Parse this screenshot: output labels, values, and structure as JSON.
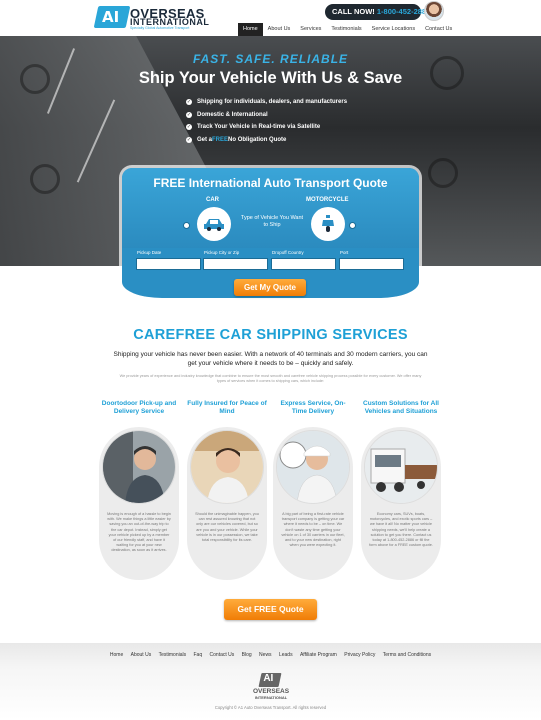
{
  "header": {
    "logo_line1": "OVERSEAS",
    "logo_line2": "INTERNATIONAL",
    "logo_tagline": "Specialty Global Automotive Transport",
    "call_label": "CALL NOW!",
    "phone": "1-800-452-2886",
    "nav": [
      "Home",
      "About Us",
      "Services",
      "Testimonials",
      "Service Locations",
      "Contact Us"
    ],
    "nav_active": "Home"
  },
  "hero": {
    "tagline": "FAST. SAFE. RELIABLE",
    "title": "Ship Your Vehicle With Us & Save",
    "bullets": [
      "Shipping for individuals, dealers, and manufacturers",
      "Domestic & International",
      "Track Your Vehicle in Real-time via Satellite"
    ],
    "bullet4_pre": "Get a ",
    "bullet4_free": "FREE",
    "bullet4_post": " No Obligation Quote"
  },
  "quote_form": {
    "title": "FREE International Auto Transport Quote",
    "car_label": "CAR",
    "motorcycle_label": "MOTORCYCLE",
    "vehicle_type_text": "Type of Vehicle You Want to Ship",
    "fields": {
      "pickup_date": "Pickup Date",
      "pickup_city": "Pickup City or Zip",
      "dropoff_country": "Dropoff Country",
      "port": "Port"
    },
    "button": "Get My Quote"
  },
  "services": {
    "title": "CAREFREE CAR SHIPPING SERVICES",
    "lead": "Shipping your vehicle has never been easier. With a network of 40 terminals and 30 modern carriers, you can get your vehicle where it needs to be – quickly and safely.",
    "small": "We provide years of experience and industry knowledge that combine to ensure the most smooth and carefree vehicle shipping process possible for every customer. We offer many types of services when it comes to shipping cars, which include:",
    "columns": [
      {
        "title": "Doortodoor Pick-up and Delivery Service",
        "text": "Moving is enough of a hassle to begin with. We make things a little easier by saving you an out-of-the-way trip to the car depot. Instead, simply get your vehicle picked up by a member of our friendly staff, and have it waiting for you at your new destination, as soon as it arrives."
      },
      {
        "title": "Fully Insured for Peace of Mind",
        "text": "Should the unimaginable happen, you can rest assured knowing that not only are our vehicles covered, but so are you and your vehicle. While your vehicle is in our possession, we take total responsibility for its care."
      },
      {
        "title": "Express Service, On-Time Delivery",
        "text": "A big part of being a first-rate vehicle transport company is getting your car where it needs to be – on time. We don't waste any time getting your vehicle on 1 of 30 carriers in our fleet, and to your new destination, right when you were expecting it."
      },
      {
        "title": "Custom Solutions for All Vehicles and Situations",
        "text": "Economy cars, SUVs, boats, motorcycles, and exotic sports cars – we have it all! No matter your vehicle shipping needs, we'll help create a solution to get you there. Contact us today at 1-800-452-2886 or fill the form above for a FREE custom quote."
      }
    ],
    "cta": "Get FREE Quote"
  },
  "footer": {
    "links": [
      "Home",
      "About Us",
      "Testimonials",
      "Faq",
      "Contact Us",
      "Blog",
      "News",
      "Leads",
      "Affiliate Program",
      "Privacy Policy",
      "Terms and Conditions"
    ],
    "logo_line1": "OVERSEAS",
    "logo_line2": "INTERNATIONAL",
    "copyright": "Copyright © A1 Auto Overseas Transport. All rights reserved"
  },
  "colors": {
    "accent_blue": "#1ea0d6",
    "cta_orange": "#f07d06",
    "dark": "#1f2830"
  }
}
